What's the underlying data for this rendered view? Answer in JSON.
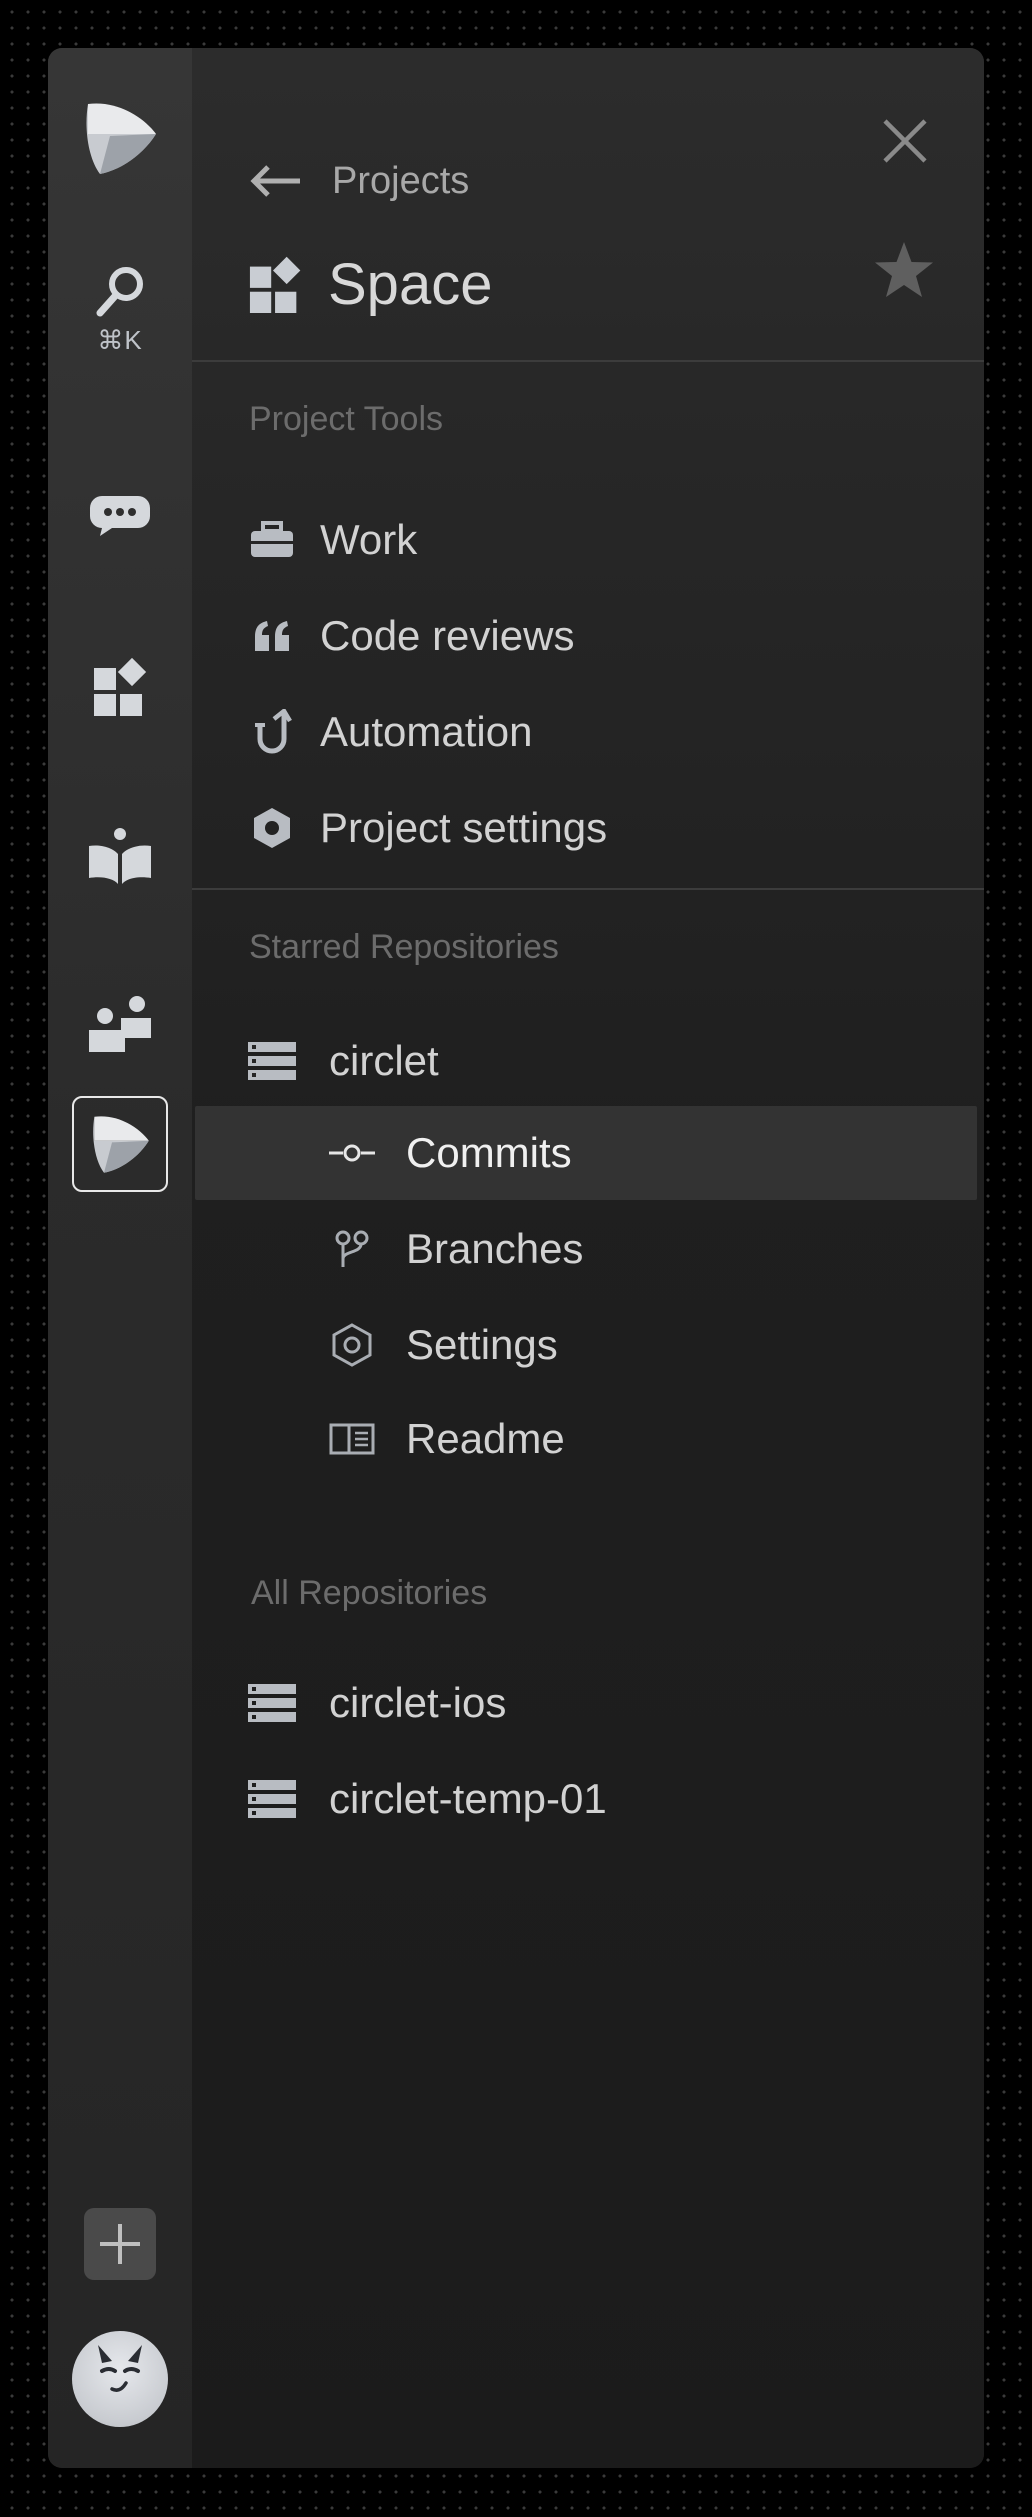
{
  "rail": {
    "search_shortcut": "⌘K"
  },
  "header": {
    "back_label": "Projects",
    "title": "Space"
  },
  "project_tools": {
    "title": "Project Tools",
    "items": [
      {
        "label": "Work",
        "icon": "briefcase-icon"
      },
      {
        "label": "Code reviews",
        "icon": "quote-icon"
      },
      {
        "label": "Automation",
        "icon": "automation-icon"
      },
      {
        "label": "Project settings",
        "icon": "hexagon-icon"
      }
    ]
  },
  "starred": {
    "title": "Starred Repositories",
    "repo": "circlet",
    "sub_items": [
      {
        "label": "Commits",
        "icon": "commit-icon",
        "selected": true
      },
      {
        "label": "Branches",
        "icon": "branch-icon"
      },
      {
        "label": "Settings",
        "icon": "settings-hex-icon"
      },
      {
        "label": "Readme",
        "icon": "readme-icon"
      }
    ]
  },
  "all_repos": {
    "title": "All Repositories",
    "items": [
      {
        "label": "circlet-ios"
      },
      {
        "label": "circlet-temp-01"
      }
    ]
  },
  "colors": {
    "background": "#000000",
    "rail": "#2f2f2f",
    "panel": "#1d1d1d",
    "selected_row": "#333333",
    "text": "#d2d2d2",
    "muted": "#6c6c6c"
  }
}
